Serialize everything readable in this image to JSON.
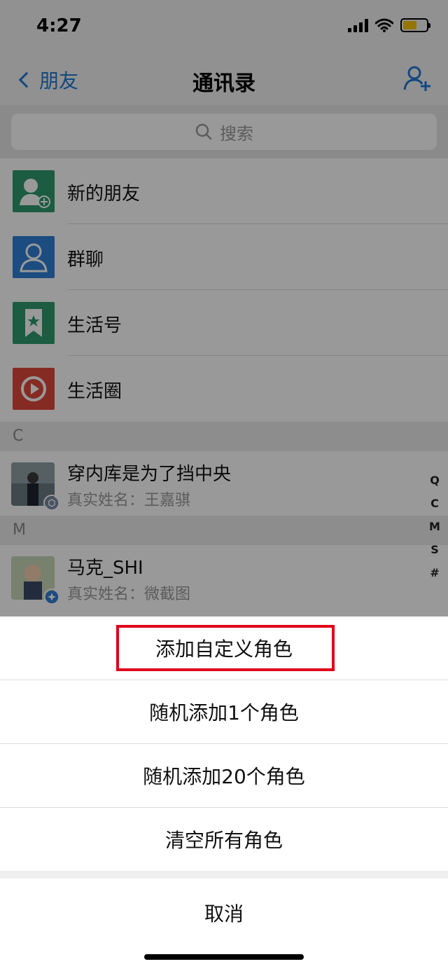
{
  "status_bar": {
    "time": "4:27"
  },
  "nav": {
    "back_label": "朋友",
    "title": "通讯录"
  },
  "search": {
    "placeholder": "搜索"
  },
  "menu_items": [
    {
      "label": "新的朋友",
      "color": "#2e9a6e"
    },
    {
      "label": "群聊",
      "color": "#2f7fd6"
    },
    {
      "label": "生活号",
      "color": "#2e9a6e"
    },
    {
      "label": "生活圈",
      "color": "#e0483b"
    }
  ],
  "sections": [
    {
      "letter": "C",
      "contacts": [
        {
          "name": "穿内库是为了挡中央",
          "real_name": "真实姓名：王嘉骐"
        }
      ]
    },
    {
      "letter": "M",
      "contacts": [
        {
          "name": "马克_SHI",
          "real_name": "真实姓名：微截图"
        }
      ]
    }
  ],
  "index_bar": [
    "Q",
    "C",
    "M",
    "S",
    "#"
  ],
  "action_sheet": {
    "options": [
      "添加自定义角色",
      "随机添加1个角色",
      "随机添加20个角色",
      "清空所有角色"
    ],
    "cancel": "取消"
  },
  "colors": {
    "accent": "#1e78d6",
    "highlight": "#e0001a"
  }
}
